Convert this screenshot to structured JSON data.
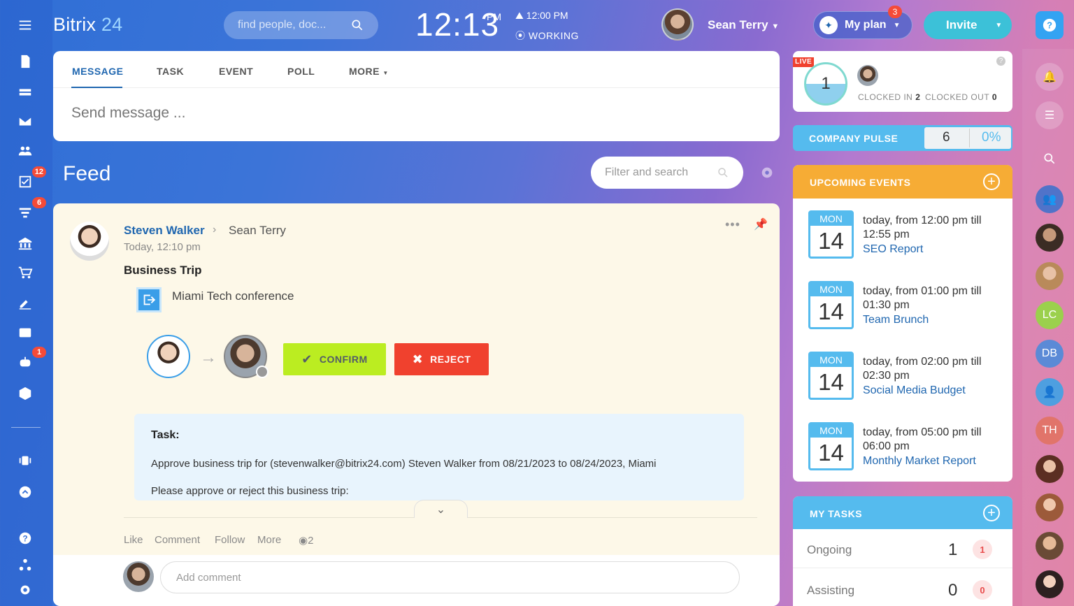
{
  "app": {
    "logo_main": "Bitrix",
    "logo_num": "24"
  },
  "header": {
    "search_placeholder": "find people, doc...",
    "clock": "12:13",
    "clock_suffix": "PM",
    "work_time": "12:00 PM",
    "work_status": "WORKING",
    "user_name": "Sean Terry",
    "plan_label": "My plan",
    "plan_badge": "3",
    "invite_label": "Invite"
  },
  "left_nav": {
    "badges": {
      "tasks": "12",
      "crm": "6",
      "bot": "1"
    }
  },
  "composer": {
    "tabs": [
      "MESSAGE",
      "TASK",
      "EVENT",
      "POLL",
      "MORE"
    ],
    "placeholder": "Send message ..."
  },
  "feed": {
    "title": "Feed",
    "filter_placeholder": "Filter and search"
  },
  "post": {
    "author": "Steven Walker",
    "recipient": "Sean Terry",
    "time": "Today, 12:10 pm",
    "title": "Business Trip",
    "trip_name": "Miami Tech conference",
    "confirm_label": "CONFIRM",
    "reject_label": "REJECT",
    "task_label": "Task:",
    "task_desc": "Approve business trip for (stevenwalker@bitrix24.com) Steven Walker from 08/21/2023 to 08/24/2023, Miami",
    "task_note": "Please approve or reject this business trip:",
    "actions": [
      "Like",
      "Comment",
      "Follow",
      "More"
    ],
    "views": "2",
    "comment_placeholder": "Add comment"
  },
  "live": {
    "badge": "LIVE",
    "count": "1",
    "clocked_in_label": "CLOCKED IN",
    "clocked_in_value": "2",
    "clocked_out_label": "CLOCKED OUT",
    "clocked_out_value": "0"
  },
  "pulse": {
    "label": "COMPANY PULSE",
    "value": "6",
    "percent": "0%"
  },
  "events": {
    "title": "UPCOMING EVENTS",
    "items": [
      {
        "day": "MON",
        "date": "14",
        "time": "today, from 12:00 pm till 12:55 pm",
        "name": "SEO Report"
      },
      {
        "day": "MON",
        "date": "14",
        "time": "today, from 01:00 pm till 01:30 pm",
        "name": "Team Brunch"
      },
      {
        "day": "MON",
        "date": "14",
        "time": "today, from 02:00 pm till 02:30 pm",
        "name": "Social Media Budget"
      },
      {
        "day": "MON",
        "date": "14",
        "time": "today, from 05:00 pm till 06:00 pm",
        "name": "Monthly Market Report"
      }
    ]
  },
  "tasks": {
    "title": "MY TASKS",
    "rows": [
      {
        "label": "Ongoing",
        "count": "1",
        "badge": "1"
      },
      {
        "label": "Assisting",
        "count": "0",
        "badge": "0"
      }
    ]
  },
  "right_nav": {
    "initials": [
      "LC",
      "DB",
      "TH"
    ]
  },
  "colors": {
    "accent": "#2067b0",
    "confirm": "#bbed21",
    "reject": "#f0412e",
    "events": "#f6ac35",
    "tasks": "#55bbee"
  }
}
